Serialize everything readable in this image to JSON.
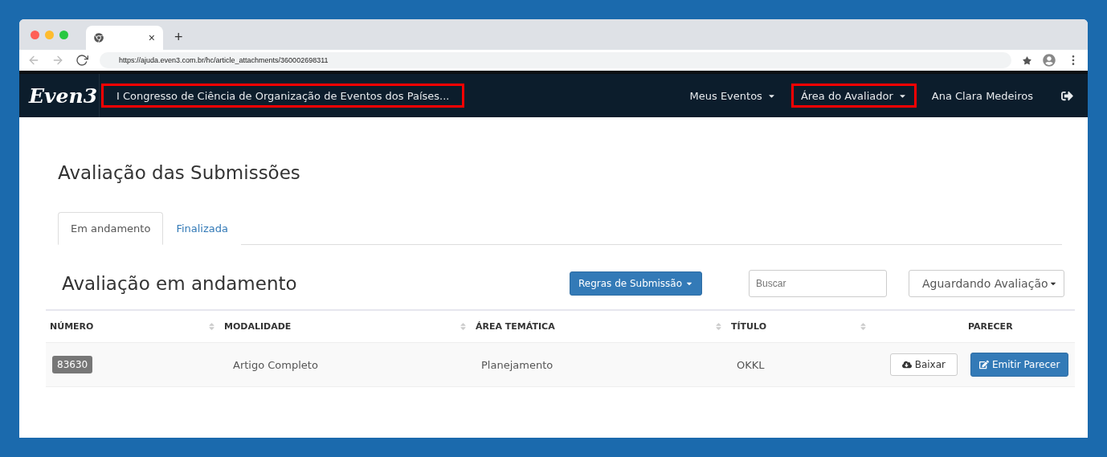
{
  "browser": {
    "tab_close": "×",
    "new_tab": "+",
    "url": "https://ajuda.even3.com.br/hc/article_attachments/360002698311"
  },
  "navbar": {
    "logo": "Even3",
    "event_title": "I Congresso de Ciência de Organização de Eventos dos Países...",
    "event_title_highlighted": true,
    "items": [
      {
        "label": "Meus Eventos",
        "dropdown": true,
        "highlighted": false
      },
      {
        "label": "Área do Avaliador",
        "dropdown": true,
        "highlighted": true
      },
      {
        "label": "Ana Clara Medeiros",
        "dropdown": false,
        "highlighted": false
      }
    ]
  },
  "page_title": "Avaliação das Submissões",
  "tabs": [
    {
      "label": "Em andamento",
      "selected": true
    },
    {
      "label": "Finalizada",
      "selected": false
    }
  ],
  "section_title": "Avaliação em andamento",
  "rules_button": "Regras de Submissão",
  "search": {
    "placeholder": "Buscar"
  },
  "status_select": {
    "value": "Aguardando Avaliação"
  },
  "table": {
    "columns": [
      {
        "label": "NÚMERO",
        "sortable": true
      },
      {
        "label": "MODALIDADE",
        "sortable": true
      },
      {
        "label": "ÁREA TEMÁTICA",
        "sortable": true
      },
      {
        "label": "TÍTULO",
        "sortable": true
      },
      {
        "label": "PARECER",
        "sortable": false
      }
    ],
    "rows": [
      {
        "number": "83630",
        "modality": "Artigo Completo",
        "area": "Planejamento",
        "title": "OKKL",
        "download": "Baixar",
        "review": "Emitir Parecer"
      }
    ]
  }
}
